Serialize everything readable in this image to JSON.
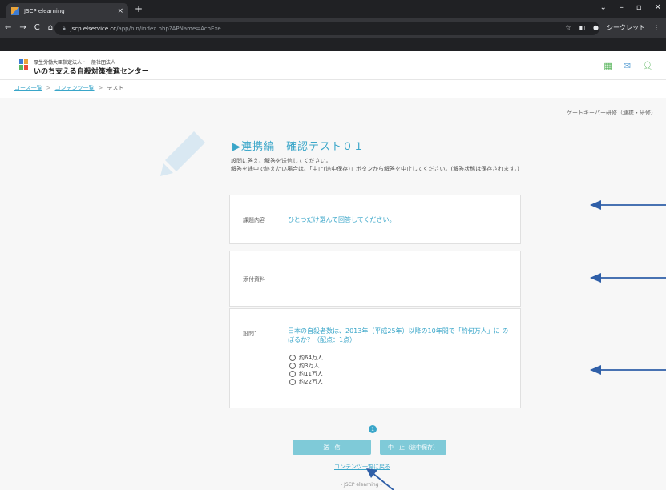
{
  "browser": {
    "tab_title": "JSCP elearning",
    "url_host": "jscp.elservice.cc",
    "url_path": "/app/bin/index.php?APName=AchExe",
    "profile_label": "シークレット"
  },
  "site": {
    "sub_title": "厚生労働大臣指定法人・一般社団法人",
    "main_title": "いのち支える自殺対策推進センター"
  },
  "breadcrumb": {
    "item1": "コース一覧",
    "item2": "コンテンツ一覧",
    "current": "テスト",
    "separator": ">"
  },
  "course_name": "ゲートキーパー研修（連携・研修）",
  "test": {
    "title": "▶連携編　確認テスト０１",
    "instruction1": "設問に答え、解答を送信してください。",
    "instruction2": "解答を途中で終えたい場合は、「中止(途中保存)」ボタンから解答を中止してください。(解答状態は保存されます。)"
  },
  "cards": {
    "task_label": "課題内容",
    "task_value": "ひとつだけ選んで回答してください。",
    "attach_label": "添付資料",
    "q1_label": "設問1",
    "q1_text": "日本の自殺者数は、2013年（平成25年）以降の10年間で「約何万人」に のぼるか？（配点：1点）",
    "options": [
      "約64万人",
      "約3万人",
      "約11万人",
      "約22万人"
    ]
  },
  "step_number": "1",
  "buttons": {
    "send": "送　信",
    "pause": "中　止（途中保存）",
    "back": "コンテンツ一覧に戻る"
  },
  "footer": "- JSCP elearning -",
  "colors": {
    "accent": "#3aa6c9",
    "button": "#7fcad8",
    "arrow": "#2f5fa8"
  }
}
